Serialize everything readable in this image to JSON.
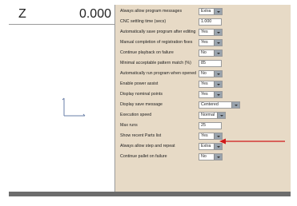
{
  "coordinate": {
    "axis": "Z",
    "value": "0.000"
  },
  "settings": [
    {
      "label": "Always allow program messages",
      "control": "dropdown",
      "value": "Extra"
    },
    {
      "label": "CNC settling time (secs)",
      "control": "text",
      "value": "1.000"
    },
    {
      "label": "Automatically save program after editing",
      "control": "dropdown",
      "value": "Yes"
    },
    {
      "label": "Manual completion of registration fixes",
      "control": "dropdown",
      "value": "Yes"
    },
    {
      "label": "Continue playback on failure",
      "control": "dropdown",
      "value": "No"
    },
    {
      "label": "Minimal acceptable pattern match (%)",
      "control": "text",
      "value": "85"
    },
    {
      "label": "Automatically run program when opened",
      "control": "dropdown",
      "value": "No"
    },
    {
      "label": "Enable power assist",
      "control": "dropdown",
      "value": "Yes"
    },
    {
      "label": "Display nominal points",
      "control": "dropdown",
      "value": "Yes"
    },
    {
      "label": "Display save message",
      "control": "dropdown",
      "value": "Centered"
    },
    {
      "label": "Execution speed",
      "control": "dropdown",
      "value": "Normal"
    },
    {
      "label": "Max runs",
      "control": "text",
      "value": "25"
    },
    {
      "label": "Show recent Parts list",
      "control": "dropdown",
      "value": "Yes"
    },
    {
      "label": "Always allow step and repeat",
      "control": "dropdown",
      "value": "Extra"
    },
    {
      "label": "Continue pallet on failure",
      "control": "dropdown",
      "value": "No"
    }
  ],
  "colors": {
    "settings_background": "#e7dac6",
    "annotation_arrow": "#d01818",
    "bottom_bar": "#6d6d6d"
  },
  "annotation": {
    "type": "arrow",
    "points_to": "Always allow step and repeat"
  }
}
